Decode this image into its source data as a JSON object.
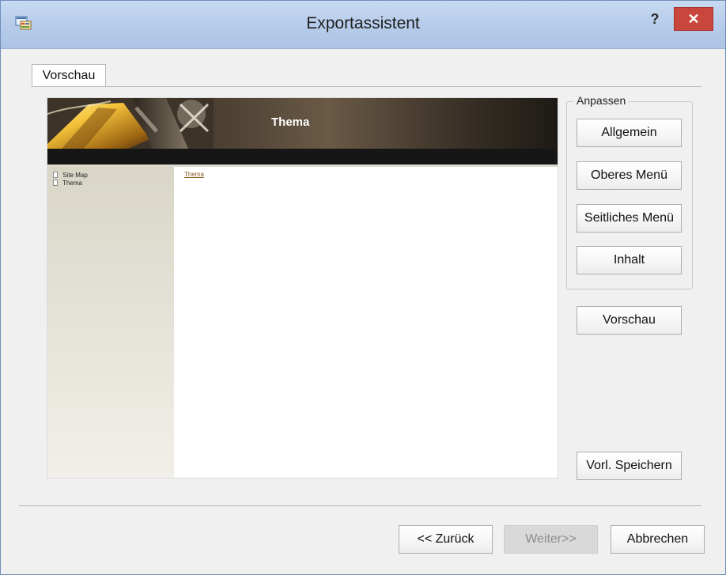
{
  "window": {
    "title": "Exportassistent",
    "help_label": "?",
    "close_label": "✕"
  },
  "tabs": [
    {
      "label": "Vorschau",
      "selected": true
    }
  ],
  "preview": {
    "banner_title": "Thema",
    "sidebar_items": [
      {
        "label": "Site Map"
      },
      {
        "label": "Thema"
      }
    ],
    "content_link": "Thema"
  },
  "customize": {
    "group_label": "Anpassen",
    "buttons": [
      {
        "label": "Allgemein"
      },
      {
        "label": "Oberes Menü"
      },
      {
        "label": "Seitliches Menü"
      },
      {
        "label": "Inhalt"
      }
    ]
  },
  "right_buttons": {
    "preview": "Vorschau",
    "save_template": "Vorl. Speichern"
  },
  "footer": {
    "back": "<< Zurück",
    "next": "Weiter>>",
    "cancel": "Abbrechen",
    "next_enabled": false
  },
  "colors": {
    "title_bar": "#b8cdea",
    "close_button": "#c9463d",
    "preview_banner": "#4d4133",
    "preview_sidebar": "#e4e1d7",
    "link": "#8b5a1d"
  },
  "icons": {
    "window": "wizard-window-icon",
    "help": "help-icon",
    "close": "close-icon",
    "tree_document": "document-icon"
  }
}
